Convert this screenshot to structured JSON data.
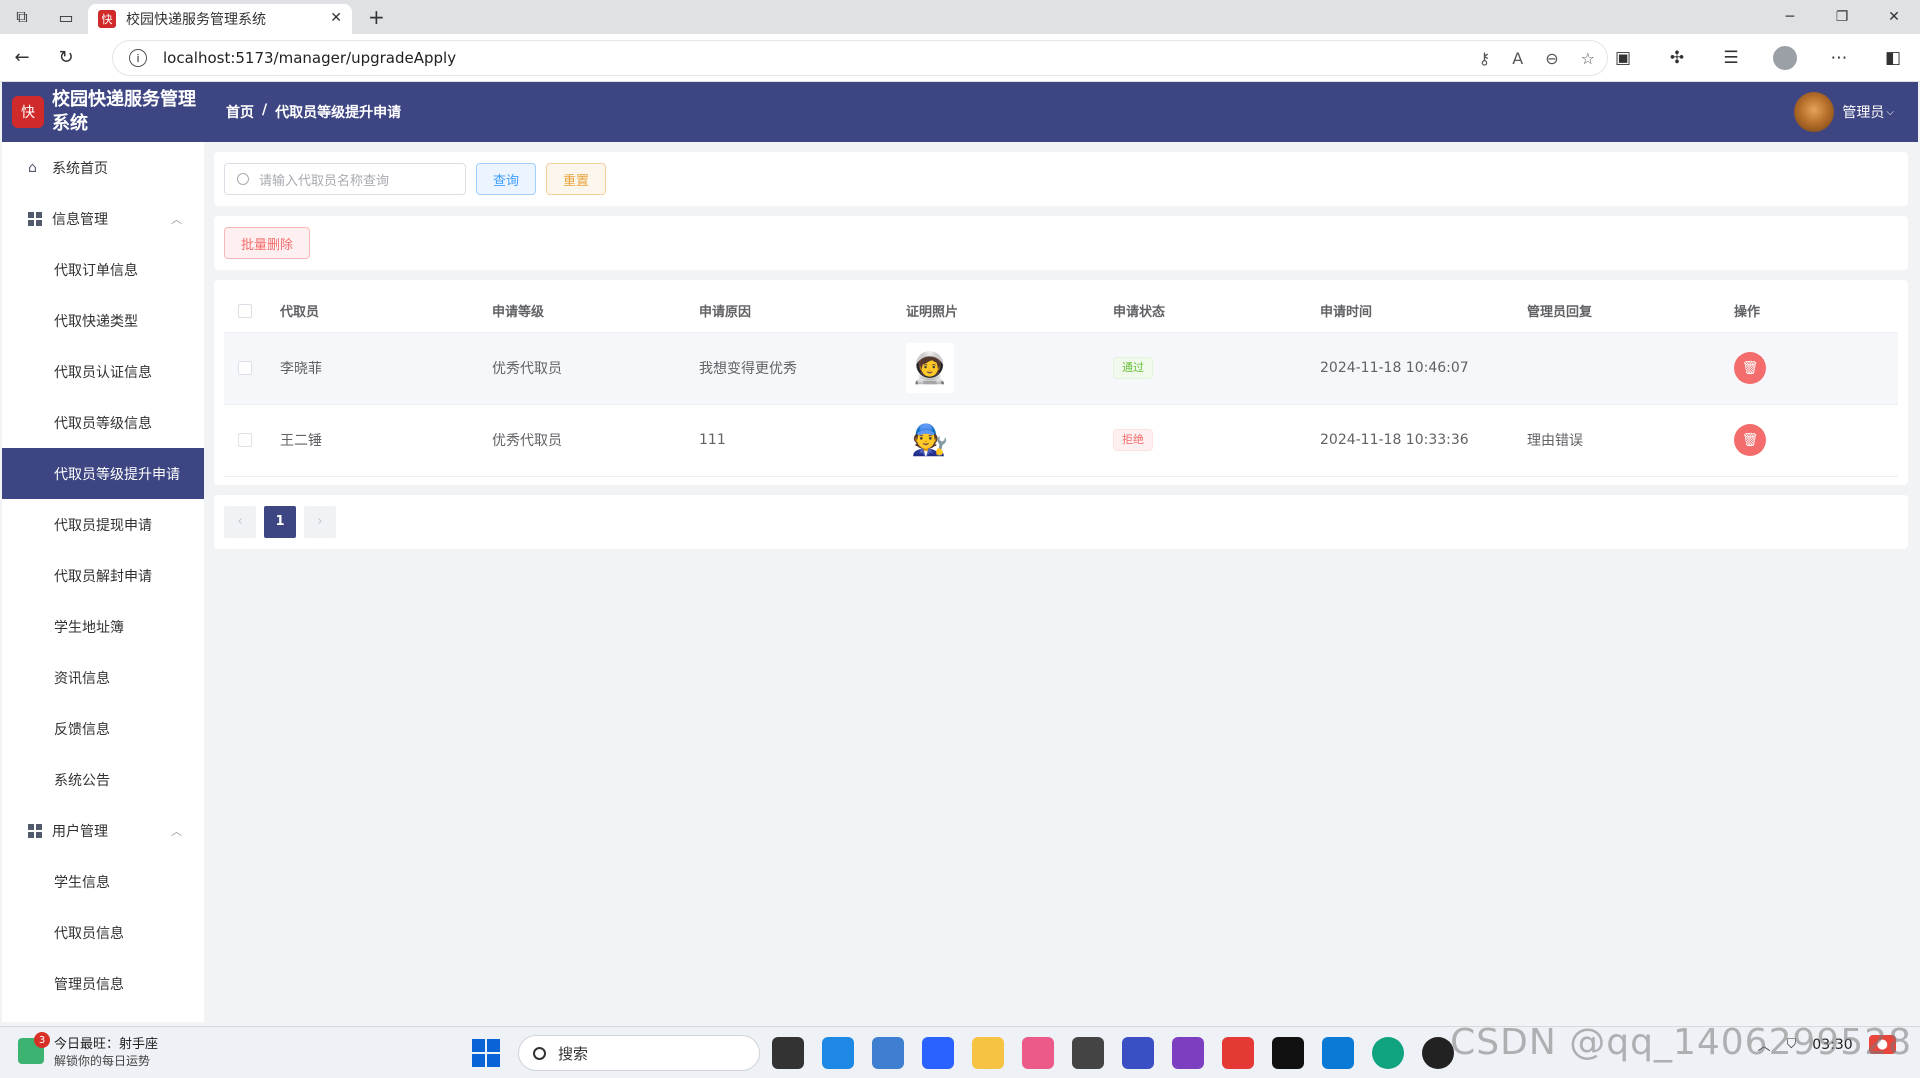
{
  "browser": {
    "tab_title": "校园快递服务管理系统",
    "url": "localhost:5173/manager/upgradeApply"
  },
  "header": {
    "app_name": "校园快递服务管理系统",
    "breadcrumb": [
      "首页",
      "代取员等级提升申请"
    ],
    "user_name": "管理员"
  },
  "sidebar": {
    "home": "系统首页",
    "groups": [
      {
        "label": "信息管理",
        "items": [
          "代取订单信息",
          "代取快递类型",
          "代取员认证信息",
          "代取员等级信息",
          "代取员等级提升申请",
          "代取员提现申请",
          "代取员解封申请",
          "学生地址簿",
          "资讯信息",
          "反馈信息",
          "系统公告"
        ]
      },
      {
        "label": "用户管理",
        "items": [
          "学生信息",
          "代取员信息",
          "管理员信息"
        ]
      }
    ],
    "active": "代取员等级提升申请"
  },
  "search": {
    "placeholder": "请输入代取员名称查询",
    "query_label": "查询",
    "reset_label": "重置"
  },
  "toolbar": {
    "batch_delete_label": "批量删除"
  },
  "table": {
    "columns": [
      "代取员",
      "申请等级",
      "申请原因",
      "证明照片",
      "申请状态",
      "申请时间",
      "管理员回复",
      "操作"
    ],
    "rows": [
      {
        "name": "李晓菲",
        "level": "优秀代取员",
        "reason": "我想变得更优秀",
        "status": "通过",
        "status_type": "success",
        "time": "2024-11-18 10:46:07",
        "reply": ""
      },
      {
        "name": "王二锤",
        "level": "优秀代取员",
        "reason": "111",
        "status": "拒绝",
        "status_type": "danger",
        "time": "2024-11-18 10:33:36",
        "reply": "理由错误"
      }
    ]
  },
  "pagination": {
    "current_page": "1"
  },
  "taskbar": {
    "weather_line1": "今日最旺：射手座",
    "weather_line2": "解锁你的每日运势",
    "badge": "3",
    "search_label": "搜索",
    "time": "03:30",
    "watermark": "CSDN @qq_1406299528"
  },
  "colors": {
    "accent": "#3d4582",
    "danger": "#f56c6c",
    "success": "#67c23a"
  }
}
